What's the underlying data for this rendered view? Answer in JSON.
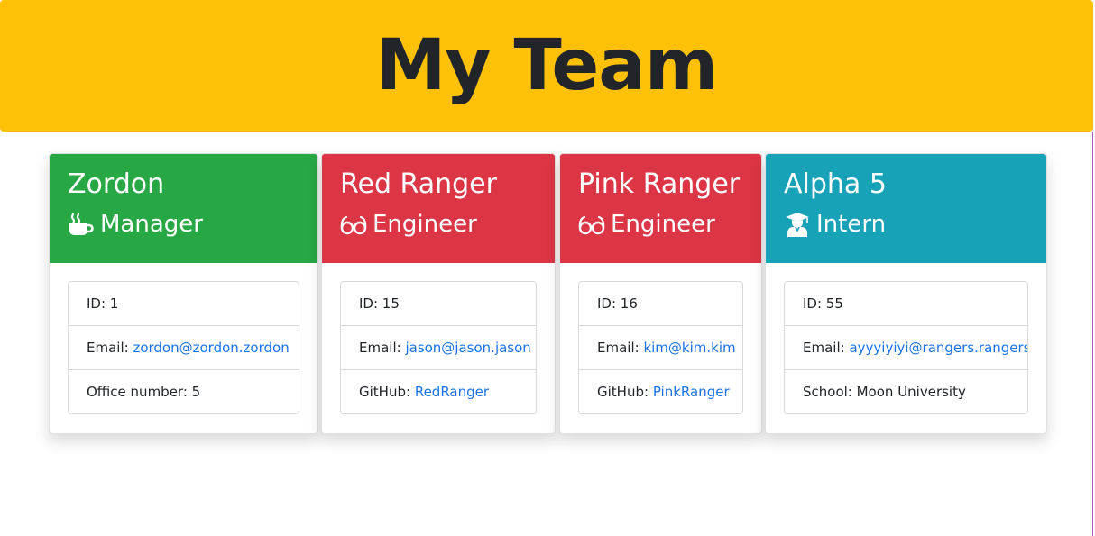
{
  "header": {
    "title": "My Team"
  },
  "colors": {
    "header_bg": "#ffc107",
    "manager": "#28a745",
    "engineer": "#dc3545",
    "intern": "#17a2b8",
    "link": "#1a73e8"
  },
  "cards": [
    {
      "name": "Zordon",
      "role": "Manager",
      "icon": "mug-icon",
      "id_label": "ID: 1",
      "email_label": "Email:",
      "email": "zordon@zordon.zordon",
      "extra_label": "Office number: 5",
      "extra_value": ""
    },
    {
      "name": "Red Ranger",
      "role": "Engineer",
      "icon": "glasses-icon",
      "id_label": "ID: 15",
      "email_label": "Email:",
      "email": "jason@jason.jason",
      "extra_label": "GitHub:",
      "extra_value": "RedRanger"
    },
    {
      "name": "Pink Ranger",
      "role": "Engineer",
      "icon": "glasses-icon",
      "id_label": "ID: 16",
      "email_label": "Email:",
      "email": "kim@kim.kim",
      "extra_label": "GitHub:",
      "extra_value": "PinkRanger"
    },
    {
      "name": "Alpha 5",
      "role": "Intern",
      "icon": "graduate-icon",
      "id_label": "ID: 55",
      "email_label": "Email:",
      "email": "ayyyiyiyi@rangers.rangers",
      "extra_label": "School: Moon University",
      "extra_value": ""
    }
  ]
}
